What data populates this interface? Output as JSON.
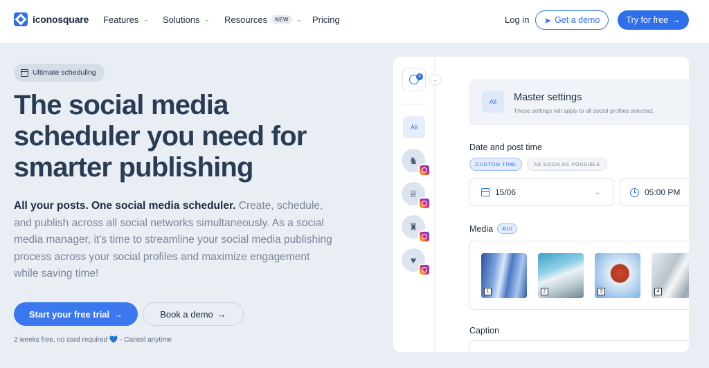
{
  "nav": {
    "brand": "iconosquare",
    "features": "Features",
    "solutions": "Solutions",
    "resources": "Resources",
    "resources_badge": "NEW",
    "pricing": "Pricing",
    "login": "Log in",
    "get_demo": "Get a demo",
    "try_free": "Try for free"
  },
  "hero": {
    "badge": "Ultimate scheduling",
    "headline": "The social media scheduler you need for smarter publishing",
    "sub_strong": "All your posts. One social media scheduler.",
    "sub_rest": " Create, schedule, and publish across all social networks simultaneously. As a social media manager, it’s time to streamline your social media publishing process across your social profiles and maximize engagement while saving time!",
    "cta_primary": "Start your free trial",
    "cta_secondary": "Book a demo",
    "fineprint_a": "2 weeks free, no card required",
    "fineprint_heart": "💙",
    "fineprint_b": " - Cancel anytime"
  },
  "app": {
    "profile_count": "4",
    "side_all": "All",
    "master_all": "All",
    "master_title": "Master settings",
    "master_sub": "These settings will apply to all social profiles selected.",
    "date_label": "Date and post time",
    "chip_custom": "CUSTOM TIME",
    "chip_asap": "AS SOON AS POSSIBLE",
    "date_value": "15/06",
    "time_value": "05:00 PM",
    "media_label": "Media",
    "media_count": "4/10",
    "thumbs": [
      "1",
      "2",
      "3",
      "4"
    ],
    "caption_label": "Caption"
  },
  "colors": {
    "accent": "#2f6fea",
    "hero_bg": "#e9eef5",
    "headline": "#293c53"
  }
}
